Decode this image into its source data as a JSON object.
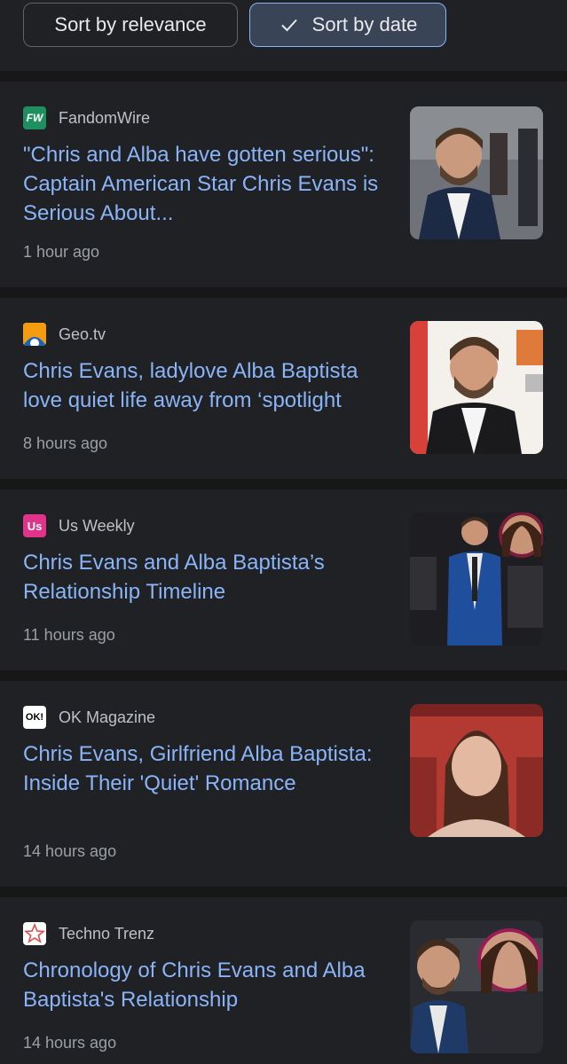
{
  "sort": {
    "relevance_label": "Sort by relevance",
    "date_label": "Sort by date"
  },
  "articles": [
    {
      "source": "FandomWire",
      "favicon_text": "FW",
      "headline": "\"Chris and Alba have gotten serious\": Captain American Star Chris Evans is Serious About...",
      "time": "1 hour ago"
    },
    {
      "source": "Geo.tv",
      "favicon_text": "",
      "headline": "Chris Evans, ladylove Alba Baptista love quiet life away from ‘spotlight",
      "time": "8 hours ago"
    },
    {
      "source": "Us Weekly",
      "favicon_text": "Us",
      "headline": "Chris Evans and Alba Baptista’s Relationship Timeline",
      "time": "11 hours ago"
    },
    {
      "source": "OK Magazine",
      "favicon_text": "OK!",
      "headline": "Chris Evans, Girlfriend Alba Baptista: Inside Their 'Quiet' Romance",
      "time": "14 hours ago"
    },
    {
      "source": "Techno Trenz",
      "favicon_text": "",
      "headline": "Chronology of Chris Evans and Alba Baptista's Relationship",
      "time": "14 hours ago"
    }
  ],
  "colors": {
    "background": "#202124",
    "link": "#8ab4f8",
    "meta": "#9aa0a6",
    "selected_chip": "#394457"
  }
}
